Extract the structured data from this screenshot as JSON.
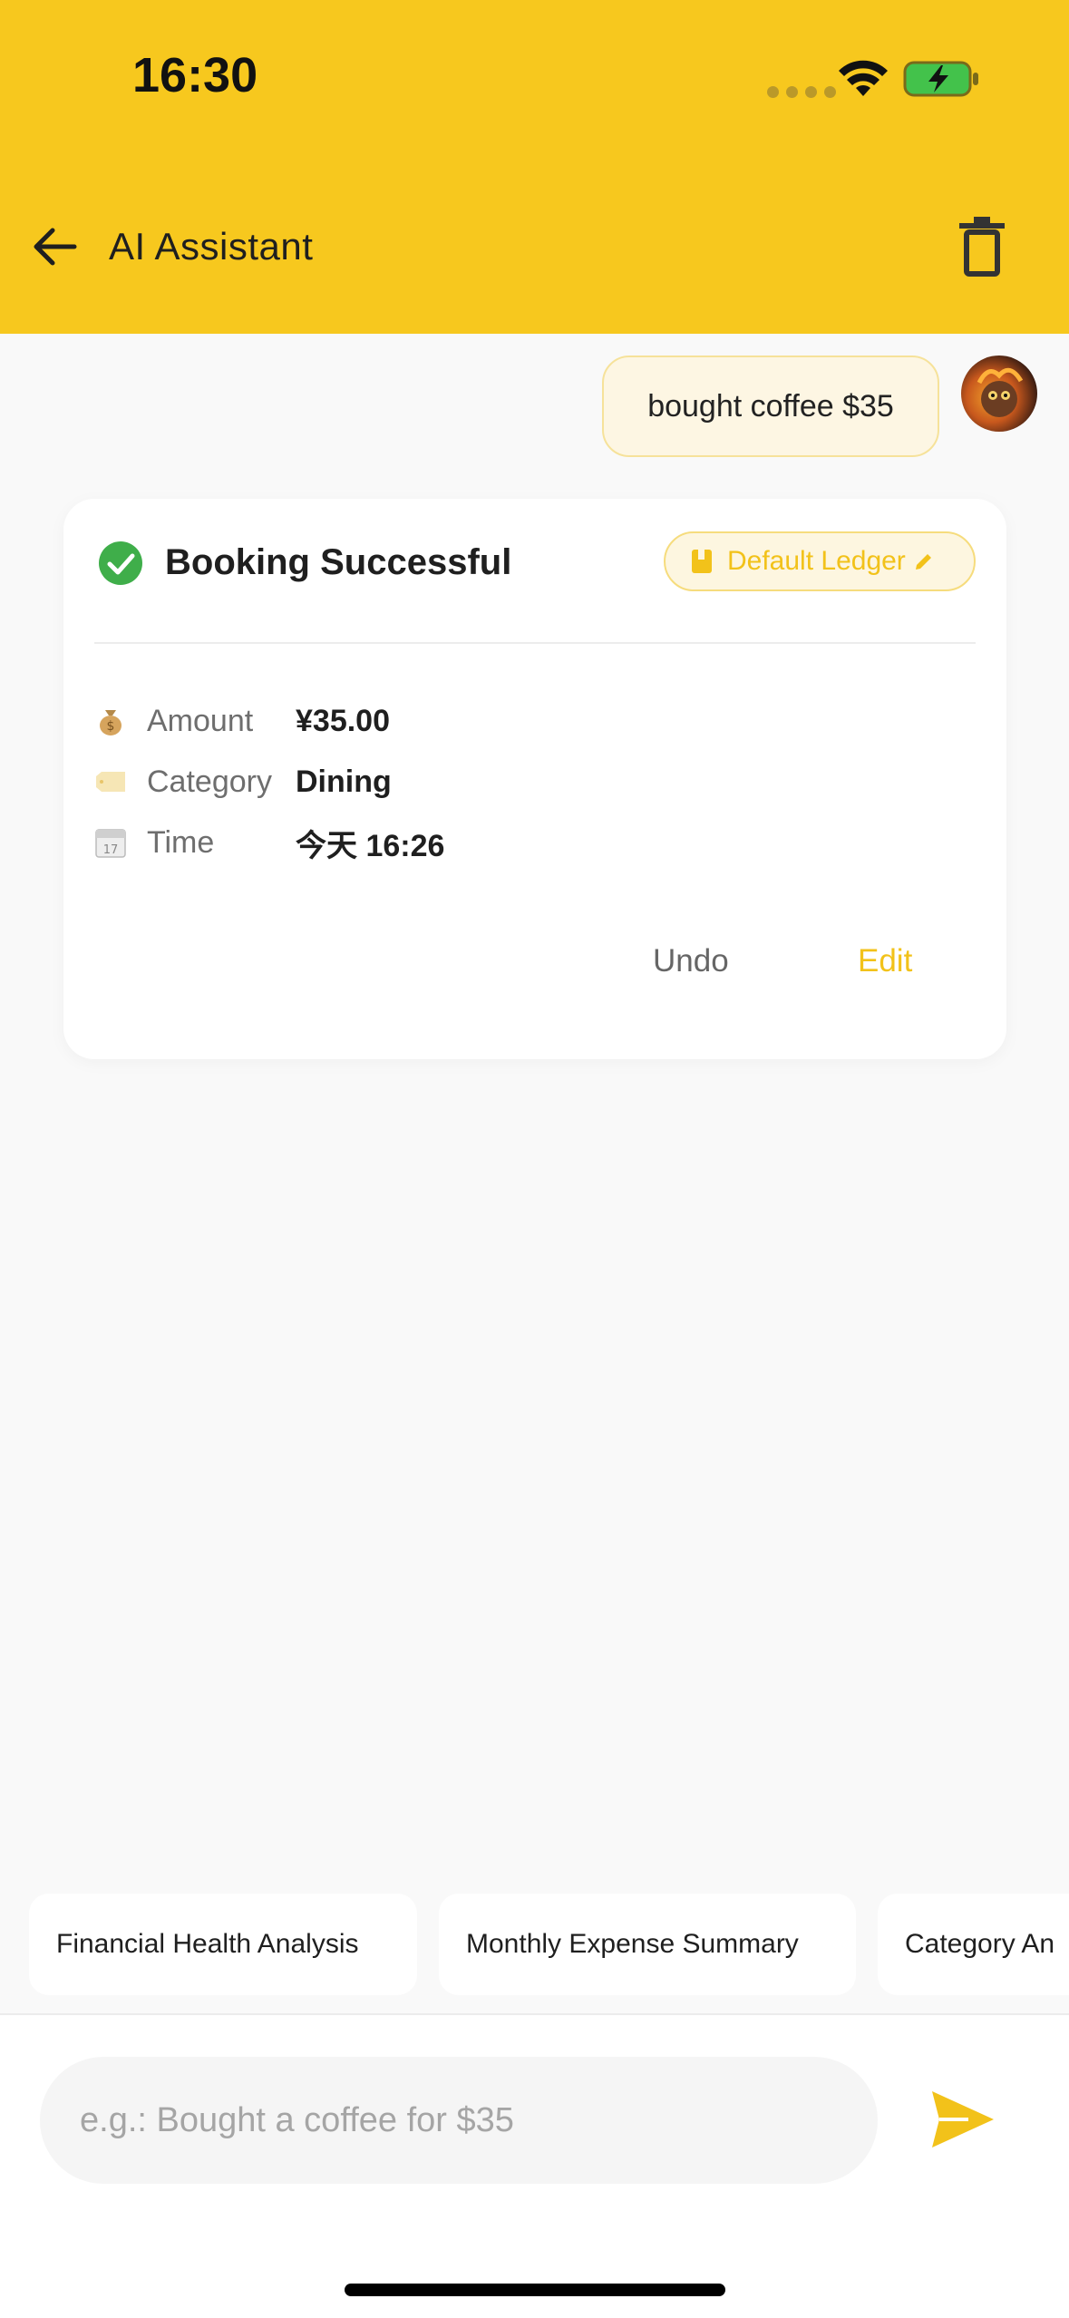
{
  "status_bar": {
    "time": "16:30"
  },
  "header": {
    "title": "AI Assistant"
  },
  "chat": {
    "user_message": "bought coffee $35"
  },
  "card": {
    "title": "Booking Successful",
    "ledger_label": "Default Ledger",
    "rows": [
      {
        "icon": "money-bag-icon",
        "label": "Amount",
        "value": "¥35.00"
      },
      {
        "icon": "tag-icon",
        "label": "Category",
        "value": "Dining"
      },
      {
        "icon": "calendar-icon",
        "label": "Time",
        "value": "今天 16:26"
      }
    ],
    "undo_label": "Undo",
    "edit_label": "Edit"
  },
  "suggestions": [
    "Financial Health Analysis",
    "Monthly Expense Summary",
    "Category An"
  ],
  "input": {
    "placeholder": "e.g.: Bought a coffee for $35"
  },
  "colors": {
    "brand": "#f7c81e",
    "accent_text": "#f2c21a",
    "success": "#3fae4a"
  }
}
